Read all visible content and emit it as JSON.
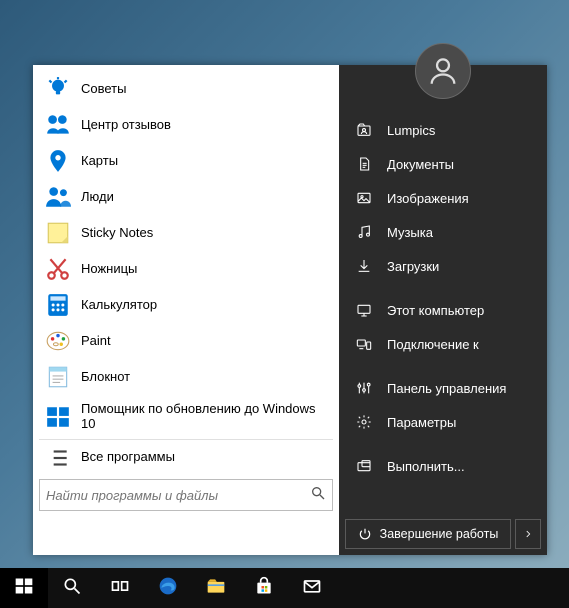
{
  "start_menu": {
    "apps": [
      {
        "label": "Советы",
        "icon": "lightbulb",
        "color": "#0078d7"
      },
      {
        "label": "Центр отзывов",
        "icon": "feedback",
        "color": "#0078d7"
      },
      {
        "label": "Карты",
        "icon": "maps",
        "color": "#0078d7"
      },
      {
        "label": "Люди",
        "icon": "people",
        "color": "#0078d7"
      },
      {
        "label": "Sticky Notes",
        "icon": "sticky",
        "color": "#fff199"
      },
      {
        "label": "Ножницы",
        "icon": "snip",
        "color": "#d04040"
      },
      {
        "label": "Калькулятор",
        "icon": "calc",
        "color": "#0078d7"
      },
      {
        "label": "Paint",
        "icon": "paint",
        "color": "#ffffff"
      },
      {
        "label": "Блокнот",
        "icon": "notepad",
        "color": "#a0d8f0"
      },
      {
        "label": "Помощник по обновлению до Windows 10",
        "icon": "update",
        "color": "#0078d7"
      }
    ],
    "all_programs": "Все программы",
    "search_placeholder": "Найти программы и файлы"
  },
  "right": {
    "items": [
      {
        "label": "Lumpics",
        "icon": "user-folder"
      },
      {
        "label": "Документы",
        "icon": "documents"
      },
      {
        "label": "Изображения",
        "icon": "pictures"
      },
      {
        "label": "Музыка",
        "icon": "music"
      },
      {
        "label": "Загрузки",
        "icon": "downloads"
      },
      {
        "gap": true
      },
      {
        "label": "Этот компьютер",
        "icon": "computer"
      },
      {
        "label": "Подключение к",
        "icon": "connect"
      },
      {
        "gap": true
      },
      {
        "label": "Панель управления",
        "icon": "control-panel"
      },
      {
        "label": "Параметры",
        "icon": "settings"
      },
      {
        "gap": true
      },
      {
        "label": "Выполнить...",
        "icon": "run"
      }
    ],
    "shutdown": "Завершение работы"
  },
  "taskbar": {
    "items": [
      {
        "name": "start",
        "icon": "win"
      },
      {
        "name": "search",
        "icon": "search"
      },
      {
        "name": "task-view",
        "icon": "taskview"
      },
      {
        "name": "edge",
        "icon": "edge"
      },
      {
        "name": "explorer",
        "icon": "explorer"
      },
      {
        "name": "store",
        "icon": "store"
      },
      {
        "name": "mail",
        "icon": "mail"
      }
    ]
  }
}
